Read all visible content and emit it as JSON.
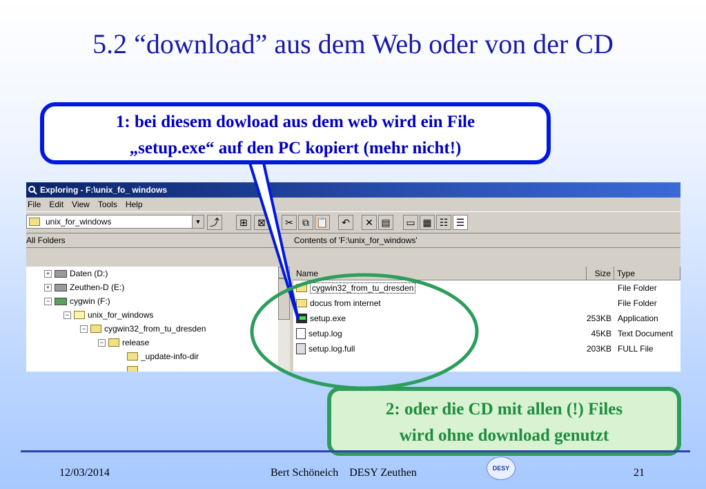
{
  "slide": {
    "title": "5.2 “download” aus dem Web oder von der CD",
    "callout1_line1": "1: bei diesem dowload aus dem web wird ein File",
    "callout1_line2": "„setup.exe“ auf den PC kopiert (mehr nicht!)",
    "callout2_line1": "2: oder die CD mit allen (!) Files",
    "callout2_line2": "wird ohne download genutzt",
    "footer_date": "12/03/2014",
    "footer_author": "Bert Schöneich    DESY Zeuthen",
    "footer_page": "21",
    "logo_text": "DESY",
    "colors": {
      "title": "#1a1aa6",
      "callout1_border": "#0018e0",
      "callout2_border": "#2e9d5c",
      "callout2_text": "#1d8d3d"
    }
  },
  "explorer": {
    "window_title": "Exploring - F:\\unix_fo_ windows",
    "menu": [
      "File",
      "Edit",
      "View",
      "Tools",
      "Help"
    ],
    "address_value": "unix_for_windows",
    "all_folders_label": "All Folders",
    "contents_label": "Contents of 'F:\\unix_for_windows'",
    "tree": [
      {
        "label": "Daten (D:)",
        "expander": "+"
      },
      {
        "label": "Zeuthen-D (E:)",
        "expander": "+"
      },
      {
        "label": "cygwin (F:)",
        "expander": "−"
      },
      {
        "label": "unix_for_windows",
        "expander": "−"
      },
      {
        "label": "cygwin32_from_tu_dresden",
        "expander": "−"
      },
      {
        "label": "release",
        "expander": "−"
      },
      {
        "label": "_update-info-dir",
        "expander": ""
      }
    ],
    "columns": {
      "name": "Name",
      "size": "Size",
      "type": "Type"
    },
    "files": [
      {
        "name": "cygwin32_from_tu_dresden",
        "size": "",
        "type": "File Folder",
        "icon": "folder-icon"
      },
      {
        "name": "docus from internet",
        "size": "",
        "type": "File Folder",
        "icon": "folder-icon"
      },
      {
        "name": "setup.exe",
        "size": "253KB",
        "type": "Application",
        "icon": "application-icon"
      },
      {
        "name": "setup.log",
        "size": "45KB",
        "type": "Text Document",
        "icon": "text-document-icon"
      },
      {
        "name": "setup.log.full",
        "size": "203KB",
        "type": "FULL File",
        "icon": "file-icon"
      }
    ]
  }
}
